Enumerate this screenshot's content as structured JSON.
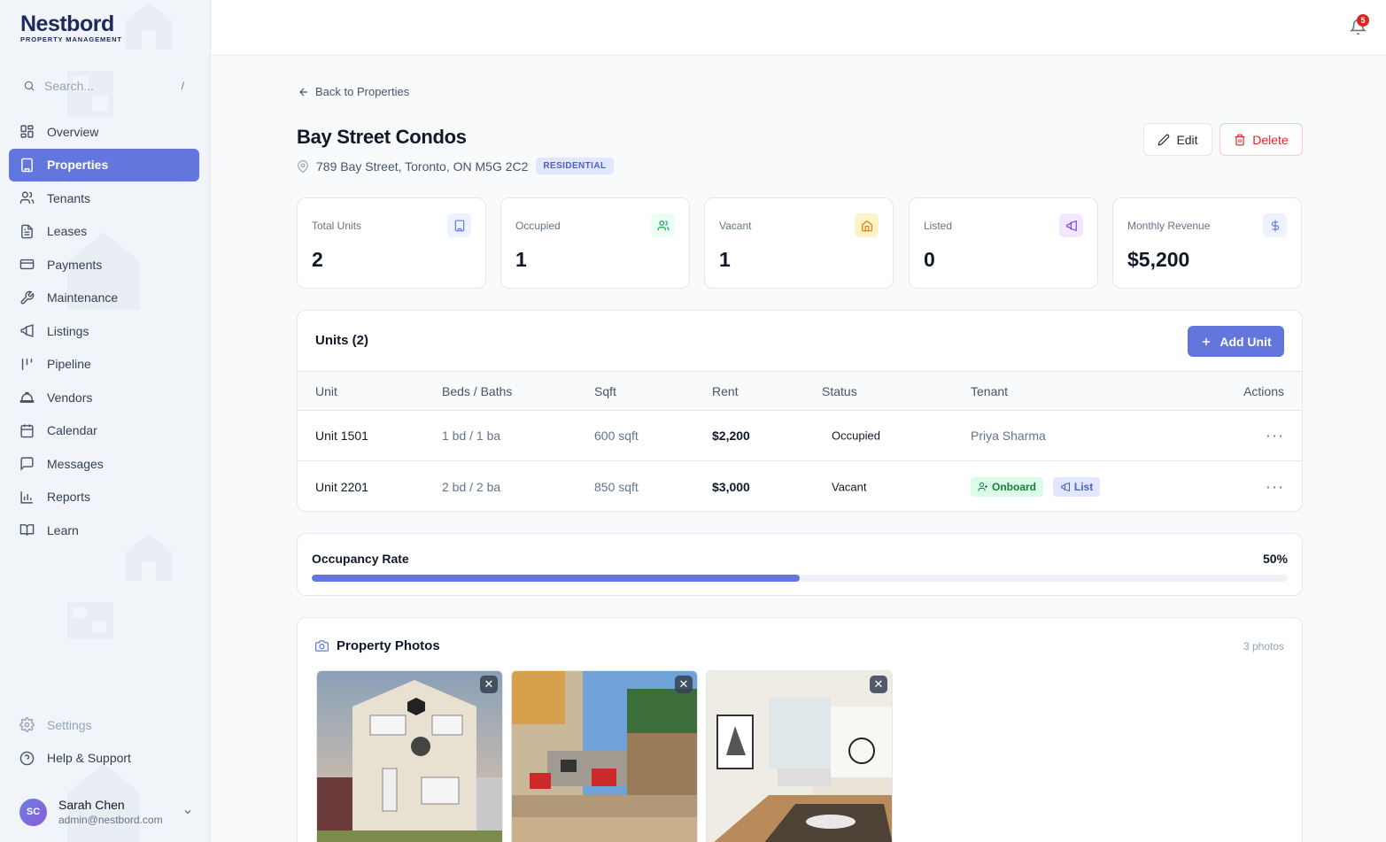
{
  "brand": {
    "name": "Nestbord",
    "tagline": "PROPERTY MANAGEMENT"
  },
  "search": {
    "placeholder": "Search...",
    "shortcut": "/"
  },
  "nav": [
    {
      "label": "Overview",
      "icon": "grid-icon"
    },
    {
      "label": "Properties",
      "icon": "building-icon",
      "active": true
    },
    {
      "label": "Tenants",
      "icon": "users-icon"
    },
    {
      "label": "Leases",
      "icon": "document-icon"
    },
    {
      "label": "Payments",
      "icon": "credit-card-icon"
    },
    {
      "label": "Maintenance",
      "icon": "wrench-icon"
    },
    {
      "label": "Listings",
      "icon": "megaphone-icon"
    },
    {
      "label": "Pipeline",
      "icon": "pipeline-icon"
    },
    {
      "label": "Vendors",
      "icon": "hard-hat-icon"
    },
    {
      "label": "Calendar",
      "icon": "calendar-icon"
    },
    {
      "label": "Messages",
      "icon": "chat-icon"
    },
    {
      "label": "Reports",
      "icon": "bar-chart-icon"
    },
    {
      "label": "Learn",
      "icon": "book-icon"
    }
  ],
  "bottom_nav": [
    {
      "label": "Settings",
      "icon": "gear-icon"
    },
    {
      "label": "Help & Support",
      "icon": "help-circle-icon"
    }
  ],
  "user": {
    "initials": "SC",
    "name": "Sarah Chen",
    "email": "admin@nestbord.com"
  },
  "notifications": {
    "count": "5"
  },
  "page": {
    "back_label": "Back to Properties",
    "title": "Bay Street Condos",
    "address": "789 Bay Street, Toronto, ON M5G 2C2",
    "type_badge": "RESIDENTIAL",
    "edit_label": "Edit",
    "delete_label": "Delete"
  },
  "stats": [
    {
      "label": "Total Units",
      "value": "2",
      "icon": "building-icon",
      "color": "#6376de",
      "bg": "#eef2ff"
    },
    {
      "label": "Occupied",
      "value": "1",
      "icon": "users-icon",
      "color": "#16a34a",
      "bg": "#ecfdf5"
    },
    {
      "label": "Vacant",
      "value": "1",
      "icon": "home-icon",
      "color": "#d97706",
      "bg": "#fef3c7"
    },
    {
      "label": "Listed",
      "value": "0",
      "icon": "megaphone-icon",
      "color": "#7c3aed",
      "bg": "#f3e8ff"
    },
    {
      "label": "Monthly Revenue",
      "value": "$5,200",
      "icon": "dollar-icon",
      "color": "#6376de",
      "bg": "#eef2ff"
    }
  ],
  "units": {
    "title": "Units (2)",
    "add_label": "Add Unit",
    "columns": [
      "Unit",
      "Beds / Baths",
      "Sqft",
      "Rent",
      "Status",
      "Tenant",
      "Actions"
    ],
    "rows": [
      {
        "unit": "Unit 1501",
        "beds": "1 bd / 1 ba",
        "sqft": "600 sqft",
        "rent": "$2,200",
        "status": "Occupied",
        "tenant": "Priya Sharma"
      },
      {
        "unit": "Unit 2201",
        "beds": "2 bd / 2 ba",
        "sqft": "850 sqft",
        "rent": "$3,000",
        "status": "Vacant",
        "onboard_label": "Onboard",
        "list_label": "List"
      }
    ]
  },
  "occupancy": {
    "label": "Occupancy Rate",
    "value": "50%",
    "fraction": 0.5
  },
  "photos": {
    "title": "Property Photos",
    "count": "3 photos"
  }
}
